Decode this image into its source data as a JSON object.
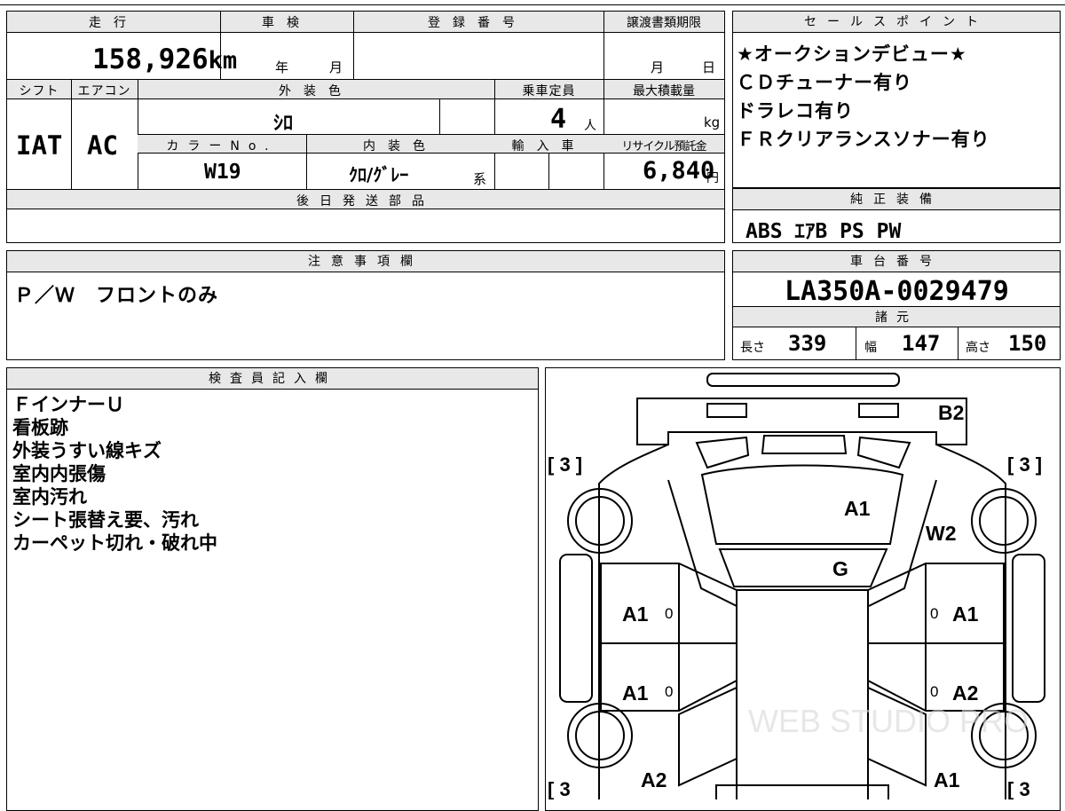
{
  "vehicle": {
    "headers": {
      "mileage": "走行",
      "shaken": "車検",
      "registration": "登録番号",
      "transfer_deadline": "譲渡書類期限",
      "shift": "シフト",
      "aircon": "エアコン",
      "exterior_color": "外装色",
      "capacity": "乗車定員",
      "max_load": "最大積載量",
      "color_no": "カラーNo.",
      "interior_color": "内装色",
      "import": "輸入車",
      "recycle": "リサイクル預託金",
      "later_parts": "後日発送部品"
    },
    "mileage": "158,926",
    "mileage_unit": "km",
    "shaken_year": "年",
    "shaken_month": "月",
    "deadline_month": "月",
    "deadline_day": "日",
    "shift": "IAT",
    "aircon": "AC",
    "exterior_color": "ｼﾛ",
    "capacity": "4",
    "capacity_unit": "人",
    "max_load_unit": "kg",
    "color_no": "W19",
    "interior_color": "ｸﾛ/ｸﾞﾚｰ",
    "interior_suffix": "系",
    "recycle_fee": "6,840",
    "recycle_unit": "円"
  },
  "sales_points": {
    "header": "セールスポイント",
    "items": [
      "★オークションデビュー★",
      "ＣＤチューナー有り",
      "ドラレコ有り",
      "ＦＲクリアランスソナー有り"
    ]
  },
  "equipment": {
    "header": "純正装備",
    "value": "ABS ｴｱB PS PW"
  },
  "notes": {
    "header": "注意事項欄",
    "value": "Ｐ／Ｗ　フロントのみ"
  },
  "chassis": {
    "header": "車台番号",
    "value": "LA350A-0029479"
  },
  "specs": {
    "header": "諸元",
    "length_label": "長さ",
    "length": "339",
    "width_label": "幅",
    "width": "147",
    "height_label": "高さ",
    "height": "150"
  },
  "inspector": {
    "header": "検査員記入欄",
    "lines": [
      "ＦインナーＵ",
      "看板跡",
      "外装うすい線キズ",
      "室内内張傷",
      "室内汚れ",
      "シート張替え要、汚れ",
      "カーペット切れ・破れ中"
    ]
  },
  "diagram": {
    "tire_left_top": "[ 3 ]",
    "tire_right_top": "[ 3 ]",
    "tire_left_bottom": "[ 3",
    "tire_right_bottom": "[ 3",
    "marks": {
      "bumper_rear": "B2",
      "roof": "A1",
      "windshield_side": "W2",
      "glass": "G",
      "left_door_front": "A1",
      "right_door_front": "A1",
      "left_door_rear": "A1",
      "right_door_rear": "A2",
      "left_rear": "A2",
      "right_rear": "A1",
      "small_l1": "0",
      "small_r1": "0",
      "small_l2": "0",
      "small_r2": "0"
    },
    "watermark": "WEB STUDIO PRO"
  }
}
